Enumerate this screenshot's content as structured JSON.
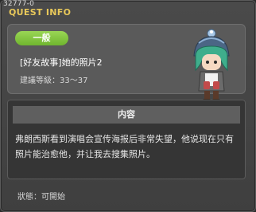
{
  "window": {
    "quest_id": "32777-0",
    "title": "QUEST INFO"
  },
  "quest": {
    "badge": "一般",
    "name": "[好友故事]她的照片2",
    "level_label": "建議等級：33〜37"
  },
  "content": {
    "header": "内容",
    "body": "弗朗西斯看到演唱会宣传海报后非常失望，他说现在只有照片能治愈他，并让我去搜集照片。"
  },
  "status": "狀態：可開始",
  "colors": {
    "title_accent": "#e8c85a",
    "badge_green": "#7cc23a"
  },
  "icons": {
    "npc": "npc-portrait-icon"
  }
}
